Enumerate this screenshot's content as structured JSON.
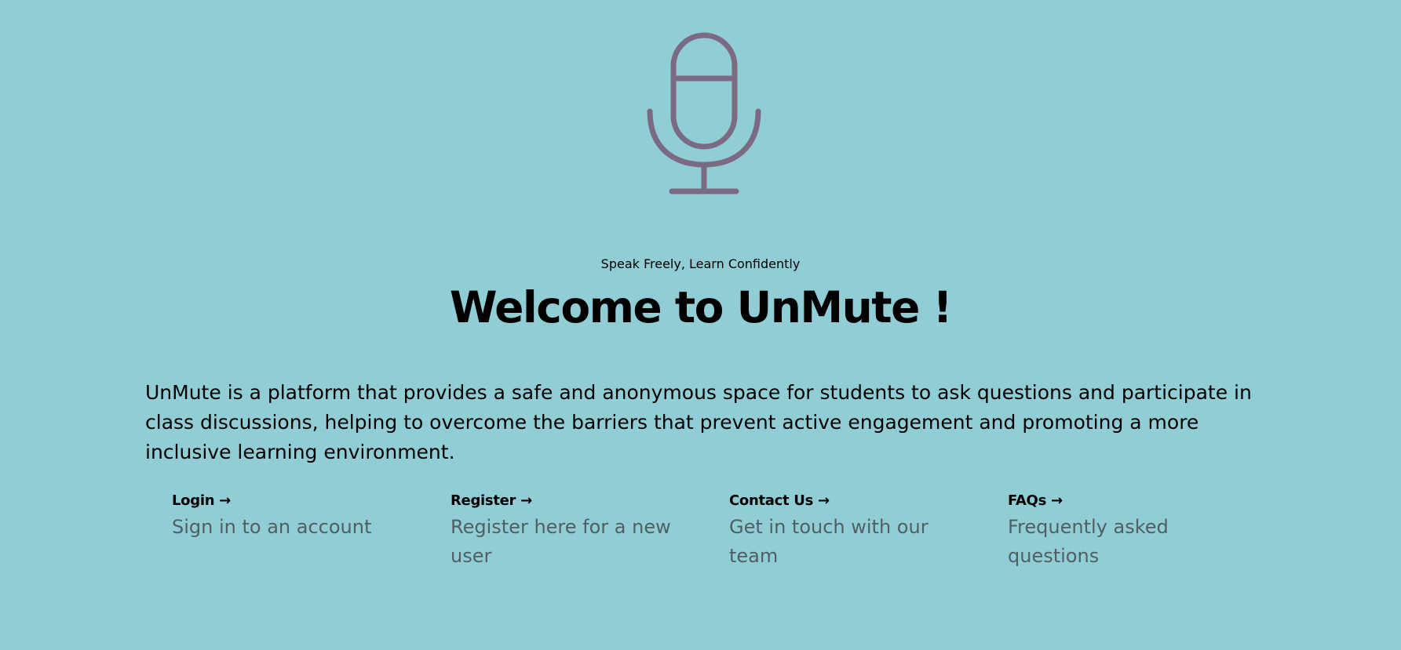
{
  "logo": {
    "icon": "microphone-icon",
    "color": "#7b6a83"
  },
  "hero": {
    "tagline": "Speak Freely, Learn Confidently",
    "title": "Welcome to UnMute !",
    "description": "UnMute is a platform that provides a safe and anonymous space for students to ask questions and participate in class discussions, helping to overcome the barriers that prevent active engagement and promoting a more inclusive learning environment."
  },
  "links": [
    {
      "title": "Login →",
      "description": "Sign in to an account"
    },
    {
      "title": "Register →",
      "description": "Register here for a new user"
    },
    {
      "title": "Contact Us →",
      "description": "Get in touch with our team"
    },
    {
      "title": "FAQs →",
      "description": "Frequently asked questions"
    }
  ],
  "colors": {
    "background": "#91cdd5",
    "text": "#000000",
    "muted_text": "#4f5f64"
  }
}
